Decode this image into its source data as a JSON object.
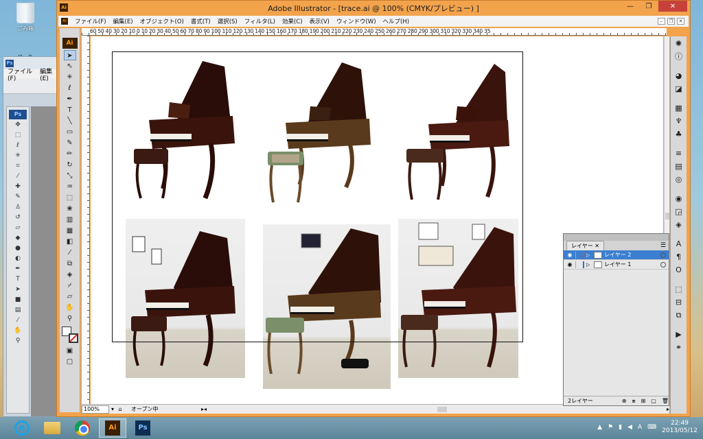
{
  "desktop": {
    "recycle_label": "ごみ箱",
    "peek_label": "ワーク"
  },
  "photoshop": {
    "logo": "Ps",
    "menu": [
      "ファイル(F)",
      "編集(E)"
    ],
    "tools_logo": "Ps"
  },
  "illustrator": {
    "title": "Adobe Illustrator - [trace.ai @ 100% (CMYK/プレビュー) ]",
    "app_icon": "Ai",
    "menu": [
      "ファイル(F)",
      "編集(E)",
      "オブジェクト(O)",
      "書式(T)",
      "選択(S)",
      "フィルタ(L)",
      "効果(C)",
      "表示(V)",
      "ウィンドウ(W)",
      "ヘルプ(H)"
    ],
    "ruler_top": "60  50  40  30  20  10   0   10  20  30  40  50  60  70  80  90  100 110 120 130 140 150 160 170 180 190 200 210 220 230 240 250 260 270 280 290 300 310 320 330 340 35",
    "tools_logo": "Ai",
    "zoom": "100%",
    "status_text": "オープン中"
  },
  "layers_panel": {
    "tab": "レイヤー",
    "layers": [
      {
        "name": "レイヤー 2",
        "color": "#d84a4a",
        "selected": true
      },
      {
        "name": "レイヤー 1",
        "color": "#3a66d0",
        "selected": false
      }
    ],
    "count": "2レイヤー"
  },
  "taskbar": {
    "ie_icon": "e",
    "ai_label": "Ai",
    "ps_label": "Ps",
    "tray_lang": "A",
    "time": "22:49",
    "date": "2013/05/12"
  },
  "photos": [
    {
      "kind": "plain",
      "bench": "dark"
    },
    {
      "kind": "plain",
      "bench": "needlepoint"
    },
    {
      "kind": "plain",
      "bench": "dark"
    },
    {
      "kind": "room",
      "bench": "dark"
    },
    {
      "kind": "room",
      "bench": "needlepoint"
    },
    {
      "kind": "room",
      "bench": "dark"
    }
  ]
}
